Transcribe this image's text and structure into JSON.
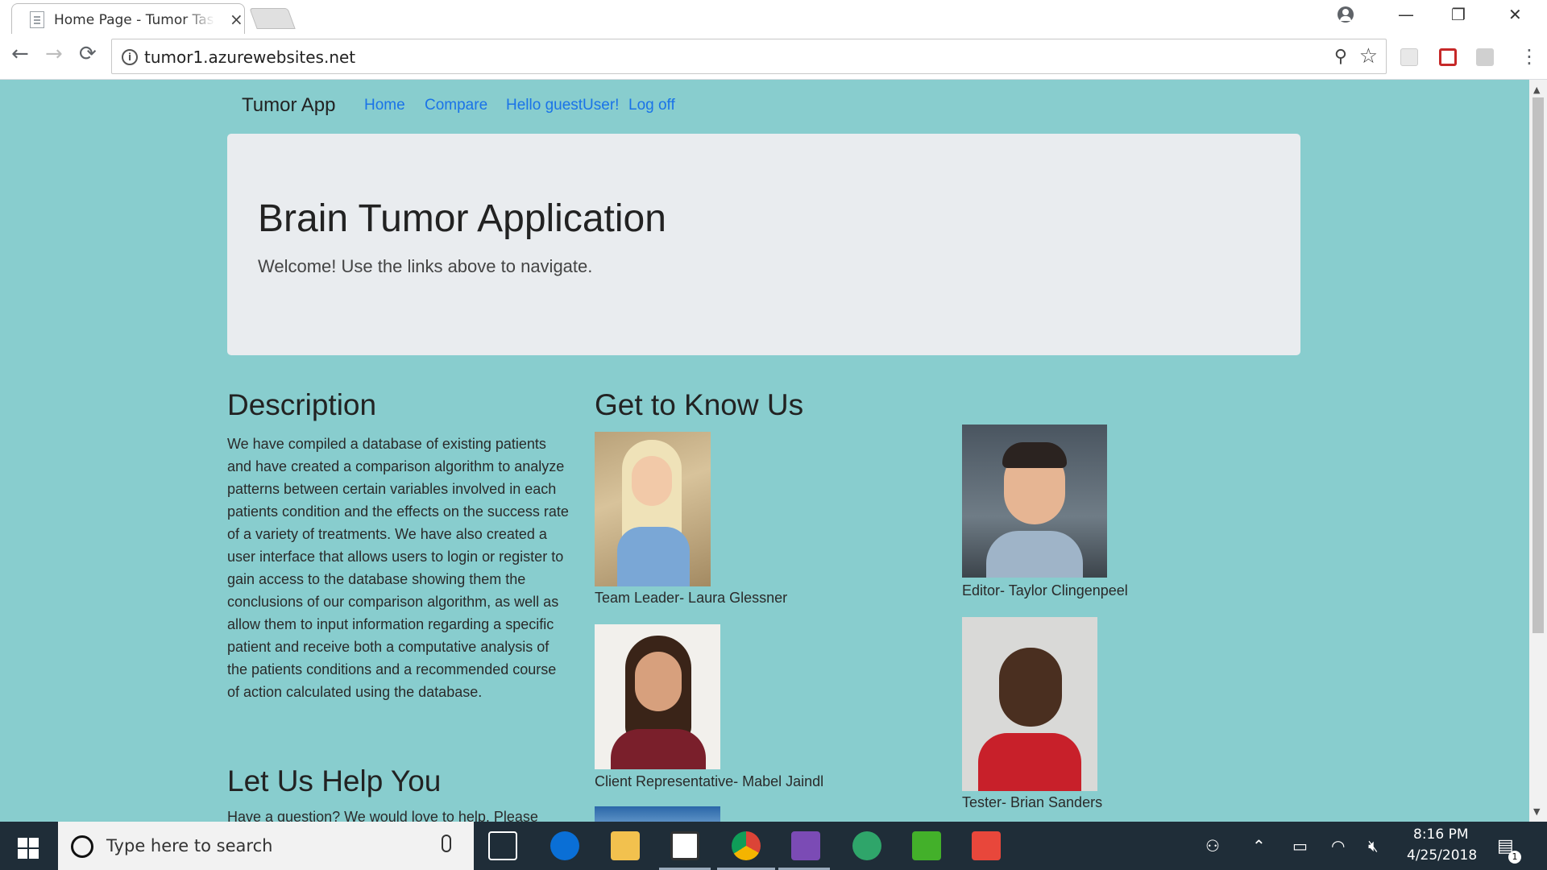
{
  "browser": {
    "tab_title": "Home Page - Tumor Task",
    "tab_close": "×",
    "url": "tumor1.azurewebsites.net",
    "window_controls": {
      "minimize": "—",
      "restore": "❐",
      "close": "✕"
    },
    "nav": {
      "back": "←",
      "forward": "→",
      "reload": "⟳"
    },
    "zoom_glyph": "⚲",
    "star_glyph": "☆",
    "info_glyph": "i",
    "menu_glyph": "⋮"
  },
  "navbar": {
    "brand": "Tumor App",
    "links": [
      {
        "label": "Home"
      },
      {
        "label": "Compare"
      },
      {
        "label": "Hello guestUser!"
      },
      {
        "label": "Log off"
      }
    ]
  },
  "jumbotron": {
    "title": "Brain Tumor Application",
    "subtitle": "Welcome! Use the links above to navigate."
  },
  "description": {
    "heading": "Description",
    "body": "We have compiled a database of existing patients and have created a comparison algorithm to analyze patterns between certain variables involved in each patients condition and the effects on the success rate of a variety of treatments. We have also created a user interface that allows users to login or register to gain access to the database showing them the conclusions of our comparison algorithm, as well as allow them to input information regarding a specific patient and receive both a computative analysis of the patients conditions and a recommended course of action calculated using the database."
  },
  "help": {
    "heading": "Let Us Help You",
    "body": "Have a question? We would love to help. Please"
  },
  "team": {
    "heading": "Get to Know Us",
    "members": [
      {
        "caption": "Team Leader- Laura Glessner"
      },
      {
        "caption": "Editor- Taylor Clingenpeel"
      },
      {
        "caption": "Client Representative- Mabel Jaindl"
      },
      {
        "caption": "Tester- Brian Sanders"
      }
    ]
  },
  "taskbar": {
    "search_placeholder": "Type here to search",
    "time": "8:16 PM",
    "date": "4/25/2018",
    "notification_count": "1"
  },
  "colors": {
    "page_background": "#88cdce",
    "jumbotron": "#e9ecef",
    "link": "#1a73e8",
    "taskbar": "#1f2d38"
  }
}
